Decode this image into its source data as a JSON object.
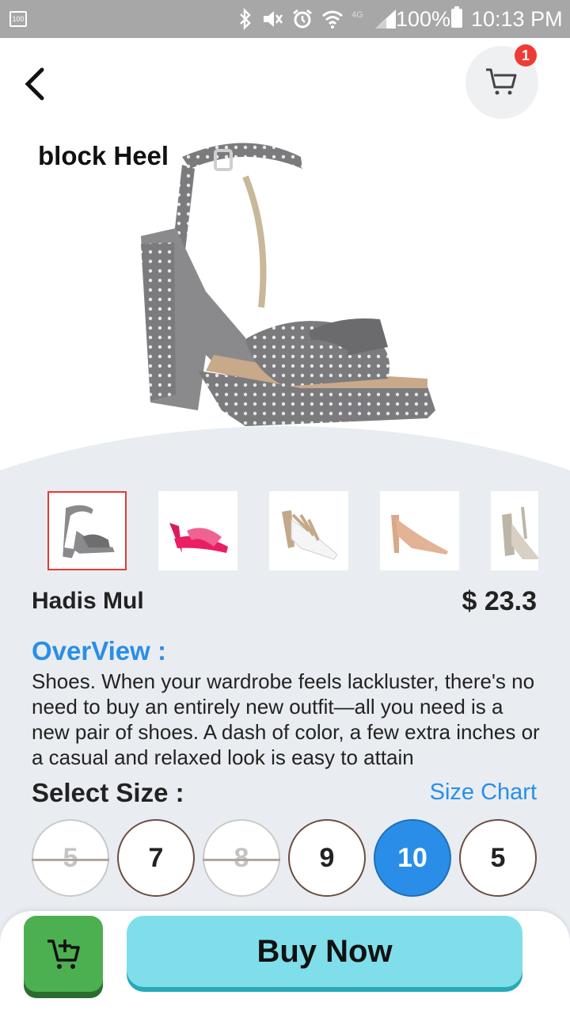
{
  "status_bar": {
    "battery_level_label": "100",
    "battery_percent": "100%",
    "time": "10:13 PM",
    "icons": [
      "bluetooth-icon",
      "mute-icon",
      "alarm-icon",
      "wifi-icon",
      "signal-icon",
      "battery-icon"
    ]
  },
  "header": {
    "back_icon": "chevron-left-icon",
    "cart_icon": "cart-icon",
    "cart_count": "1"
  },
  "product": {
    "category": "block Heel",
    "name": "Hadis Mul",
    "price": "$ 23.3",
    "overview_title": "OverView :",
    "overview_text": "Shoes. When your wardrobe feels lackluster, there's no need to buy an entirely new outfit—all you need is a new pair of shoes. A dash of color, a few extra inches or a casual and relaxed look is easy to attain"
  },
  "thumbnails": [
    {
      "name": "grey-studded-block-heel",
      "selected": true
    },
    {
      "name": "pink-slide-mule",
      "selected": false
    },
    {
      "name": "studded-slingback-pump",
      "selected": false
    },
    {
      "name": "nude-pointed-pump",
      "selected": false
    },
    {
      "name": "snakeskin-t-strap-heel",
      "selected": false
    }
  ],
  "sizes": {
    "title": "Select Size :",
    "chart_link": "Size Chart",
    "options": [
      {
        "label": "5",
        "state": "disabled"
      },
      {
        "label": "7",
        "state": "available"
      },
      {
        "label": "8",
        "state": "disabled"
      },
      {
        "label": "9",
        "state": "available"
      },
      {
        "label": "10",
        "state": "selected"
      },
      {
        "label": "5",
        "state": "available"
      }
    ]
  },
  "actions": {
    "add_to_cart_icon": "cart-plus-icon",
    "buy_label": "Buy Now"
  },
  "colors": {
    "accent": "#2a8ee8",
    "buy_button": "#80deea",
    "add_cart_button": "#4caf50",
    "badge": "#ef3b35"
  }
}
